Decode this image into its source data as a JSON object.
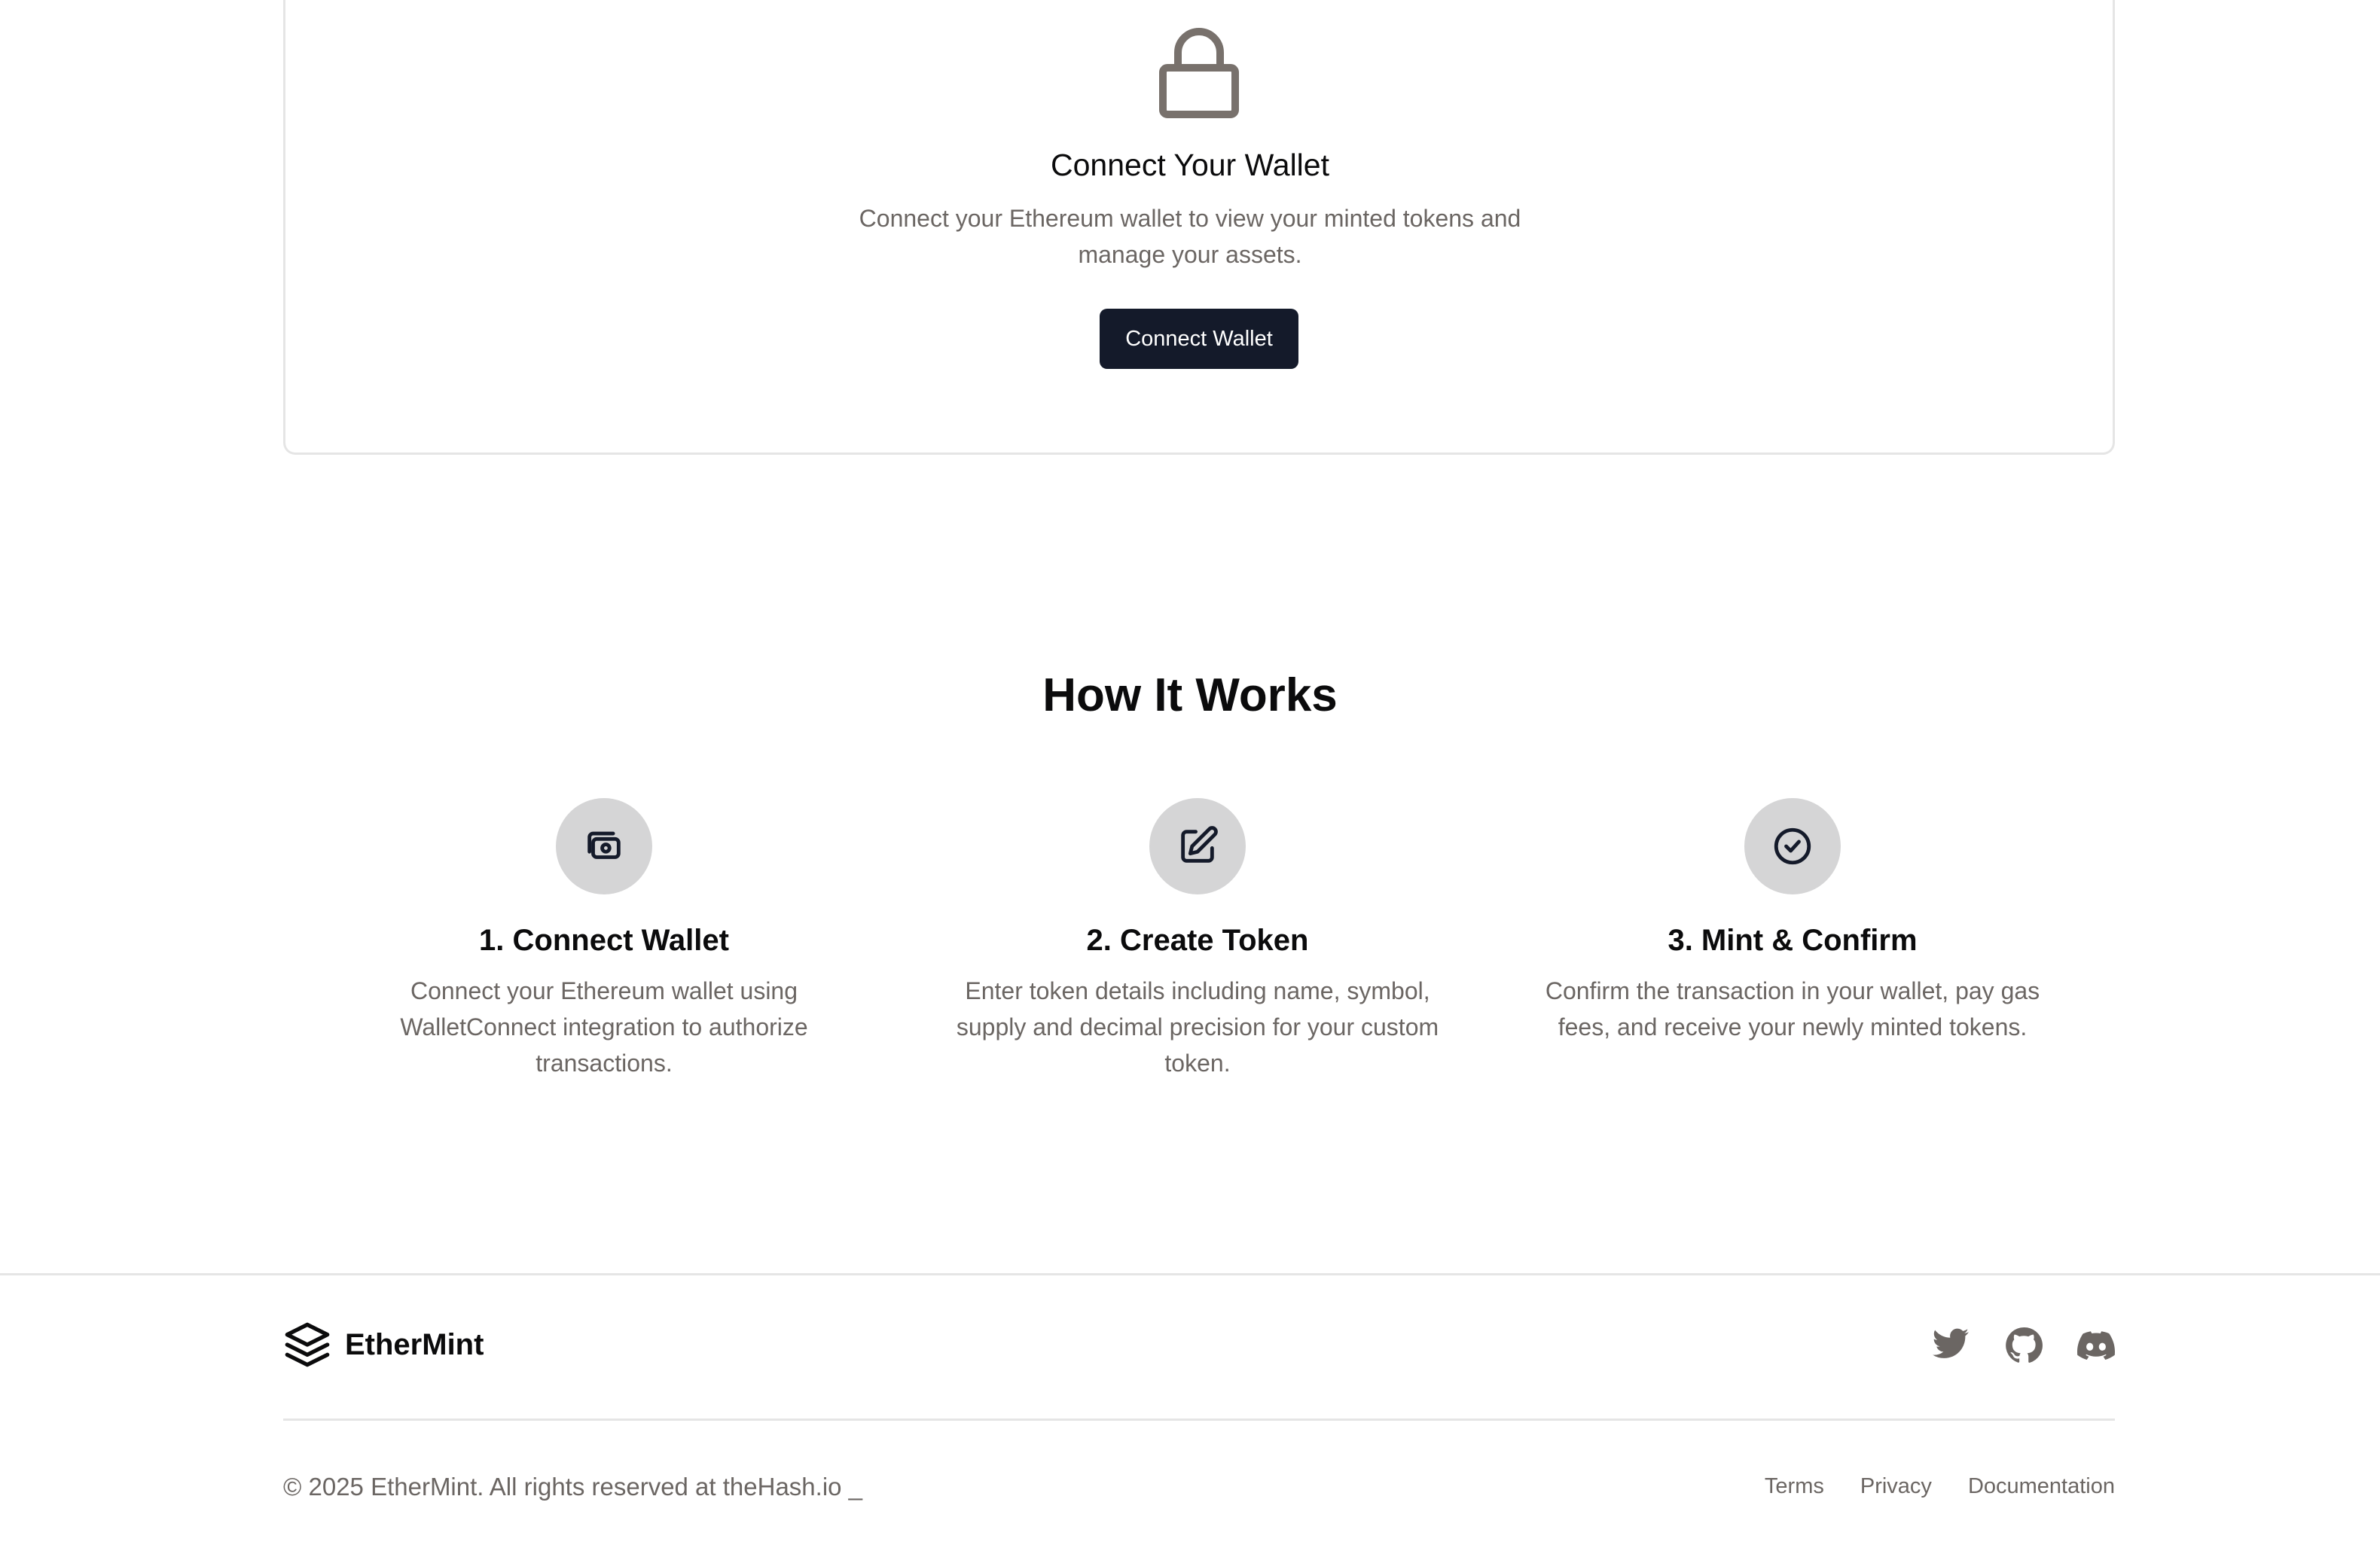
{
  "wallet_card": {
    "icon": "lock-icon",
    "title": "Connect Your Wallet",
    "description": "Connect your Ethereum wallet to view your minted tokens and manage your assets.",
    "button_label": "Connect Wallet"
  },
  "how_it_works": {
    "title": "How It Works",
    "steps": [
      {
        "icon": "wallet-icon",
        "title": "1. Connect Wallet",
        "description": "Connect your Ethereum wallet using WalletConnect integration to authorize transactions."
      },
      {
        "icon": "edit-icon",
        "title": "2. Create Token",
        "description": "Enter token details including name, symbol, supply and decimal precision for your custom token."
      },
      {
        "icon": "check-circle-icon",
        "title": "3. Mint & Confirm",
        "description": "Confirm the transaction in your wallet, pay gas fees, and receive your newly minted tokens."
      }
    ]
  },
  "footer": {
    "brand_name": "EtherMint",
    "brand_icon": "layers-icon",
    "socials": [
      "twitter-icon",
      "github-icon",
      "discord-icon"
    ],
    "copyright": "© 2025 EtherMint. All rights reserved at theHash.io _",
    "links": [
      "Terms",
      "Privacy",
      "Documentation"
    ]
  },
  "colors": {
    "button_bg": "#141a2a",
    "muted_text": "#6b6663",
    "icon_circle": "#d5d5d6",
    "border": "#e5e5e5"
  }
}
